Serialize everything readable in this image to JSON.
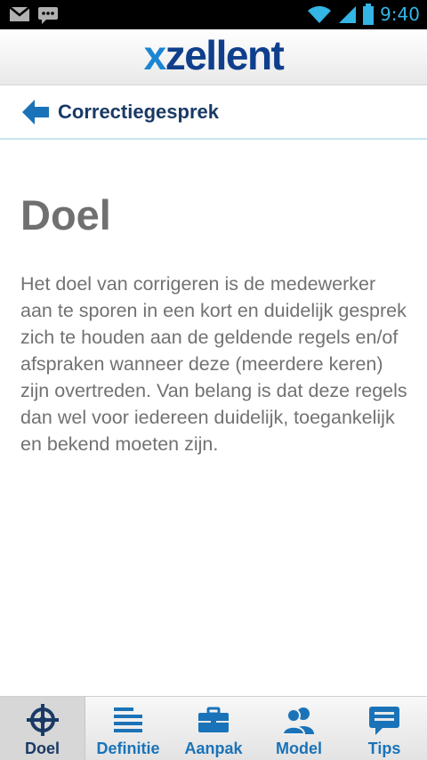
{
  "status_bar": {
    "time": "9:40",
    "icons": [
      "gmail-icon",
      "message-icon",
      "wifi-icon",
      "signal-icon",
      "battery-icon"
    ]
  },
  "header": {
    "logo_x": "x",
    "logo_rest": "zellent"
  },
  "navbar": {
    "back_icon": "back-arrow-icon",
    "title": "Correctiegesprek"
  },
  "content": {
    "heading": "Doel",
    "paragraph": "Het doel van corrigeren is de medewerker aan te sporen in een kort en duidelijk gesprek zich te houden aan de geldende regels en/of afspraken wanneer deze (meerdere keren) zijn overtreden. Van belang is dat deze regels dan wel voor iedereen duidelijk, toegankelijk en bekend moeten zijn."
  },
  "tabs": [
    {
      "label": "Doel",
      "icon": "target-icon",
      "active": true
    },
    {
      "label": "Definitie",
      "icon": "list-icon",
      "active": false
    },
    {
      "label": "Aanpak",
      "icon": "briefcase-icon",
      "active": false
    },
    {
      "label": "Model",
      "icon": "people-icon",
      "active": false
    },
    {
      "label": "Tips",
      "icon": "speech-bubble-icon",
      "active": false
    }
  ],
  "colors": {
    "accent_blue": "#1a73b8",
    "dark_navy": "#1a3a66",
    "logo_blue": "#1b86d2",
    "status_blue": "#33b5e5",
    "text_gray": "#727272"
  }
}
